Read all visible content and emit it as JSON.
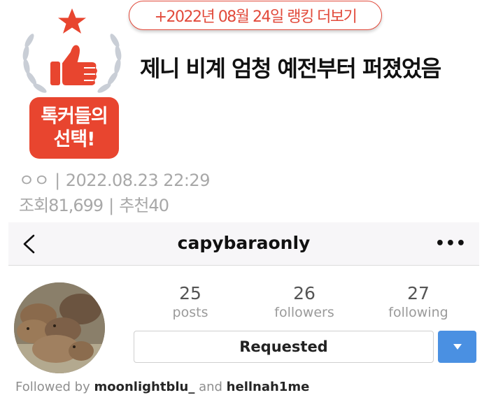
{
  "rank_link": "+2022년 08월 24일 랭킹 더보기",
  "badge": {
    "line1": "톡커들의",
    "line2": "선택!",
    "icons": [
      "star-icon",
      "laurel-icon",
      "thumbs-up-icon"
    ]
  },
  "post": {
    "title": "제니 비계 엄청 예전부터 퍼졌었음",
    "author": "ㅇㅇ",
    "datetime": "2022.08.23 22:29",
    "views_label": "조회",
    "views": "81,699",
    "recommend_label": "추천",
    "recommends": "40"
  },
  "instagram": {
    "back_icon": "chevron-left-icon",
    "username": "capybaraonly",
    "more_icon": "ellipsis-icon",
    "stats": [
      {
        "count": "25",
        "label": "posts"
      },
      {
        "count": "26",
        "label": "followers"
      },
      {
        "count": "27",
        "label": "following"
      }
    ],
    "requested_label": "Requested",
    "dropdown_icon": "caret-down-icon",
    "followed_by_prefix": "Followed by",
    "follower1": "moonlightblu_",
    "and_word": "and",
    "follower2": "hellnah1me"
  },
  "colors": {
    "accent_red": "#e24a3b",
    "badge_red": "#e8452f",
    "instagram_blue": "#4a90e2",
    "laurel_grey": "#c9ced6"
  }
}
